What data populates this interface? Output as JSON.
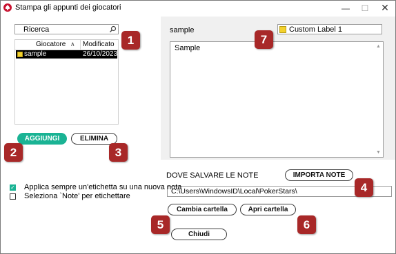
{
  "window": {
    "title": "Stampa gli appunti dei giocatori",
    "icon": "pokerstars-spade-icon"
  },
  "search": {
    "value": "Ricerca"
  },
  "player_list": {
    "columns": [
      "Giocatore",
      "Modificato"
    ],
    "rows": [
      {
        "name": "sample",
        "modified": "26/10/2023",
        "label_color": "#f3d12c",
        "selected": true
      }
    ]
  },
  "buttons": {
    "add": "AGGIUNGI",
    "delete": "ELIMINA",
    "import_notes": "IMPORTA NOTE",
    "change_folder": "Cambia cartella",
    "open_folder": "Apri cartella",
    "close": "Chiudi"
  },
  "note_panel": {
    "player_name": "sample",
    "label": "Custom Label 1",
    "label_color": "#f3d12c",
    "note_text": "Sample"
  },
  "save_location": {
    "heading": "DOVE SALVARE LE NOTE",
    "path": "C:\\Users\\WindowsID\\Local\\PokerStars\\"
  },
  "options": [
    {
      "label": "Applica sempre un'etichetta su una nuova nota",
      "checked": true
    },
    {
      "label": "Seleziona `Note' per etichettare",
      "checked": false
    }
  ],
  "markers": [
    "1",
    "2",
    "3",
    "4",
    "5",
    "6",
    "7"
  ],
  "colors": {
    "accent_green": "#1ab394",
    "marker_red": "#a82828",
    "label_yellow": "#f3d12c"
  }
}
